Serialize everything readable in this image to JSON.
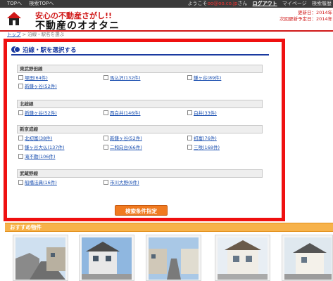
{
  "topbar": {
    "links": [
      "TOPへ",
      "検索TOPへ"
    ],
    "welcome_prefix": "ようこそ",
    "user_name": "oo@oo.co.jp",
    "welcome_suffix": "さん",
    "logout": "ログアウト",
    "mypage": "マイページ",
    "search_history": "検索履歴"
  },
  "header": {
    "catch_copy": "安心の不動産さがし!!",
    "brand": "不動産のオオタニ",
    "update_line1": "更新日：2014年",
    "update_line2": "次回更新予定日：2014年"
  },
  "breadcrumb": {
    "home": "トップ",
    "sep": " > ",
    "current": "沿線・駅名を選ぶ"
  },
  "section_title": "沿線・駅を選択する",
  "lines": [
    {
      "name": "東武野田線",
      "stations": [
        "塚田(64件)",
        "馬込沢(132件)",
        "鎌ヶ谷(89件)",
        "新鎌ヶ谷(52件)"
      ]
    },
    {
      "name": "北総線",
      "stations": [
        "新鎌ヶ谷(52件)",
        "西白井(146件)",
        "白井(33件)"
      ]
    },
    {
      "name": "新京成線",
      "stations": [
        "北初富(38件)",
        "新鎌ヶ谷(52件)",
        "初富(76件)",
        "鎌ヶ谷大仏(137件)",
        "二和向台(66件)",
        "三咲(168件)",
        "滝不動(106件)"
      ]
    },
    {
      "name": "武蔵野線",
      "stations": [
        "船橋法典(16件)",
        "市川大野(9件)"
      ]
    }
  ],
  "search_button": "検索条件指定",
  "recommend_title": "おすすめ物件",
  "colors": {
    "accent_red": "#d01818",
    "frame_red": "#ef1010",
    "title_blue": "#1a3aa0",
    "button_orange": "#f07a20",
    "recommend_orange": "#f7b24a"
  }
}
